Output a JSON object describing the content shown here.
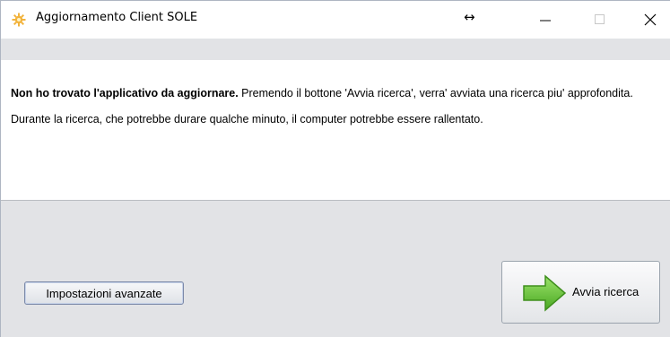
{
  "window": {
    "title": "Aggiornamento Client SOLE",
    "resize_glyph": "↔",
    "icon": "gear-sun-icon",
    "controls": [
      "minimize-icon",
      "maximize-icon",
      "close-icon"
    ]
  },
  "message": {
    "bold_lead": "Non ho trovato l'applicativo da aggiornare.",
    "lead_rest": " Premendo il bottone 'Avvia ricerca', verra' avviata una ricerca piu' approfondita.",
    "second": "Durante la ricerca, che potrebbe durare qualche minuto, il computer potrebbe essere rallentato."
  },
  "buttons": {
    "advanced_label": "Impostazioni avanzate",
    "search_label": "Avvia ricerca",
    "search_icon": "green-right-arrow-icon"
  },
  "colors": {
    "panel_bg": "#e2e3e6",
    "arrow_green": "#6cc53a",
    "icon_yellow": "#f2c14e"
  }
}
